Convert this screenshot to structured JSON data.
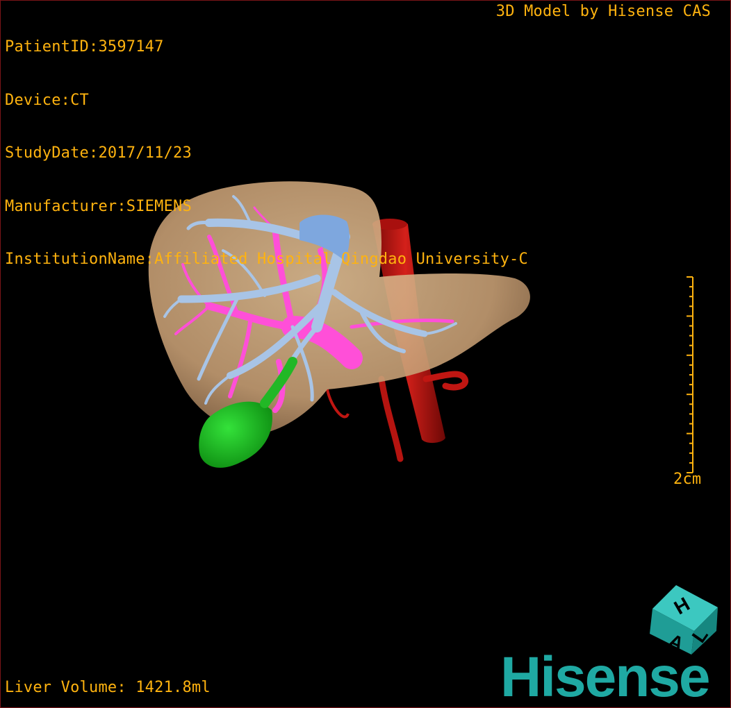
{
  "header": {
    "patient_id": "PatientID:3597147",
    "device": "Device:CT",
    "study_date": "StudyDate:2017/11/23",
    "manufacturer": "Manufacturer:SIEMENS",
    "institution": "InstitutionName:Affiliated Hospital Qingdao University-C",
    "vendor_credit": "3D Model by Hisense CAS"
  },
  "footer": {
    "liver_volume": "Liver Volume: 1421.8ml"
  },
  "scale_bar": {
    "label": "2cm"
  },
  "orientation_cube": {
    "faces": [
      "H",
      "A",
      "L"
    ]
  },
  "brand": {
    "logo_text": "Hisense"
  },
  "colors": {
    "hud_text": "#ffb30f",
    "border": "#7a1518",
    "liver": "#c8a27a",
    "hepatic_vein": "#a8c4e6",
    "portal_vein": "#ff4fd8",
    "artery": "#c81412",
    "gallbladder": "#16c41a",
    "brand": "#1fa9a3"
  }
}
